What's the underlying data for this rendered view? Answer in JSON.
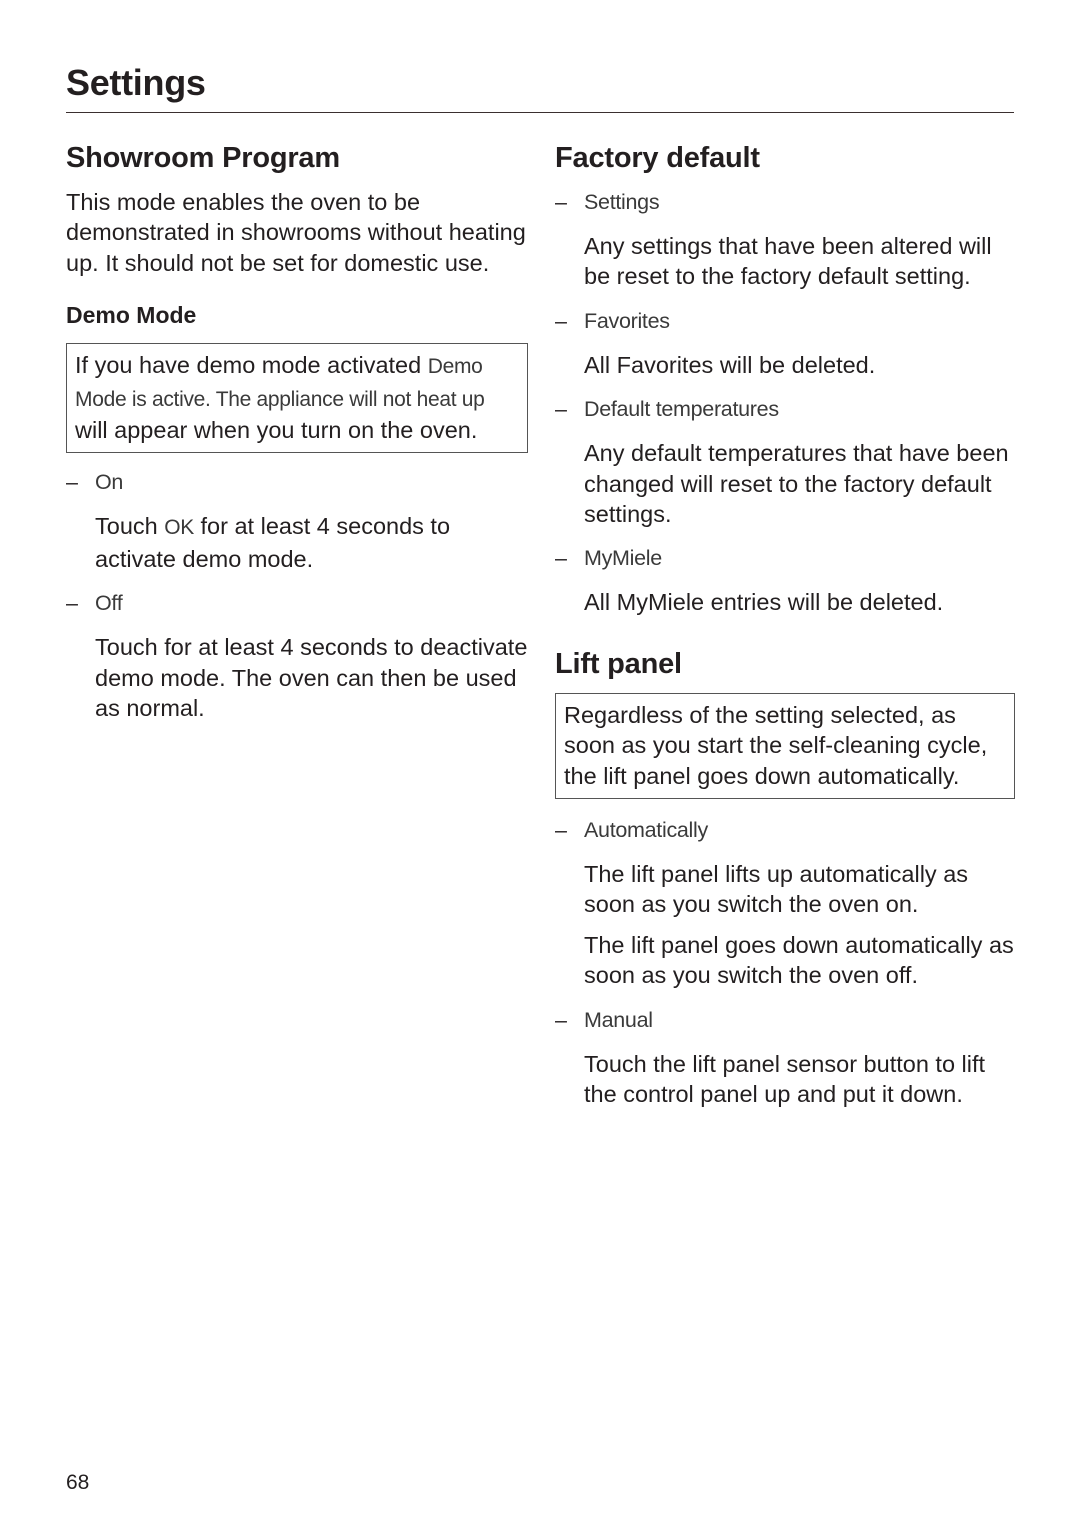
{
  "page": {
    "title": "Settings",
    "page_number": "68"
  },
  "showroom": {
    "heading": "Showroom Program",
    "intro": "This mode enables the oven to be demonstrated in showrooms without heating up. It should not be set for domestic use.",
    "subheading": "Demo Mode",
    "note": {
      "prefix": "If you have demo mode activated ",
      "display_text": "Demo Mode is active. The appliance will not heat up",
      "suffix": " will appear when you turn on the oven."
    },
    "options": [
      {
        "label": "On",
        "desc_prefix": "Touch ",
        "desc_key": "OK",
        "desc_suffix": " for at least 4 seconds to activate demo mode."
      },
      {
        "label": "Off",
        "desc": "Touch for at least 4 seconds to deactivate demo mode. The oven can then be used as normal."
      }
    ]
  },
  "factory_default": {
    "heading": "Factory default",
    "options": [
      {
        "label": "Settings",
        "desc": "Any settings that have been altered will be reset to the factory default setting."
      },
      {
        "label": "Favorites",
        "desc": "All Favorites will be deleted."
      },
      {
        "label": "Default temperatures",
        "desc": "Any default temperatures that have been changed will reset to the factory default settings."
      },
      {
        "label": "MyMiele",
        "desc": "All MyMiele entries will be deleted."
      }
    ]
  },
  "lift_panel": {
    "heading": "Lift panel",
    "note": "Regardless of the setting selected, as soon as you start the self-cleaning cycle, the lift panel goes down automatically.",
    "options": [
      {
        "label": "Automatically",
        "desc": [
          "The lift panel lifts up automatically as soon as you switch the oven on.",
          "The lift panel goes down automatically as soon as you switch the oven off."
        ]
      },
      {
        "label": "Manual",
        "desc": [
          "Touch the lift panel sensor button to lift the control panel up and put it down."
        ]
      }
    ]
  },
  "dash_symbol": "–"
}
